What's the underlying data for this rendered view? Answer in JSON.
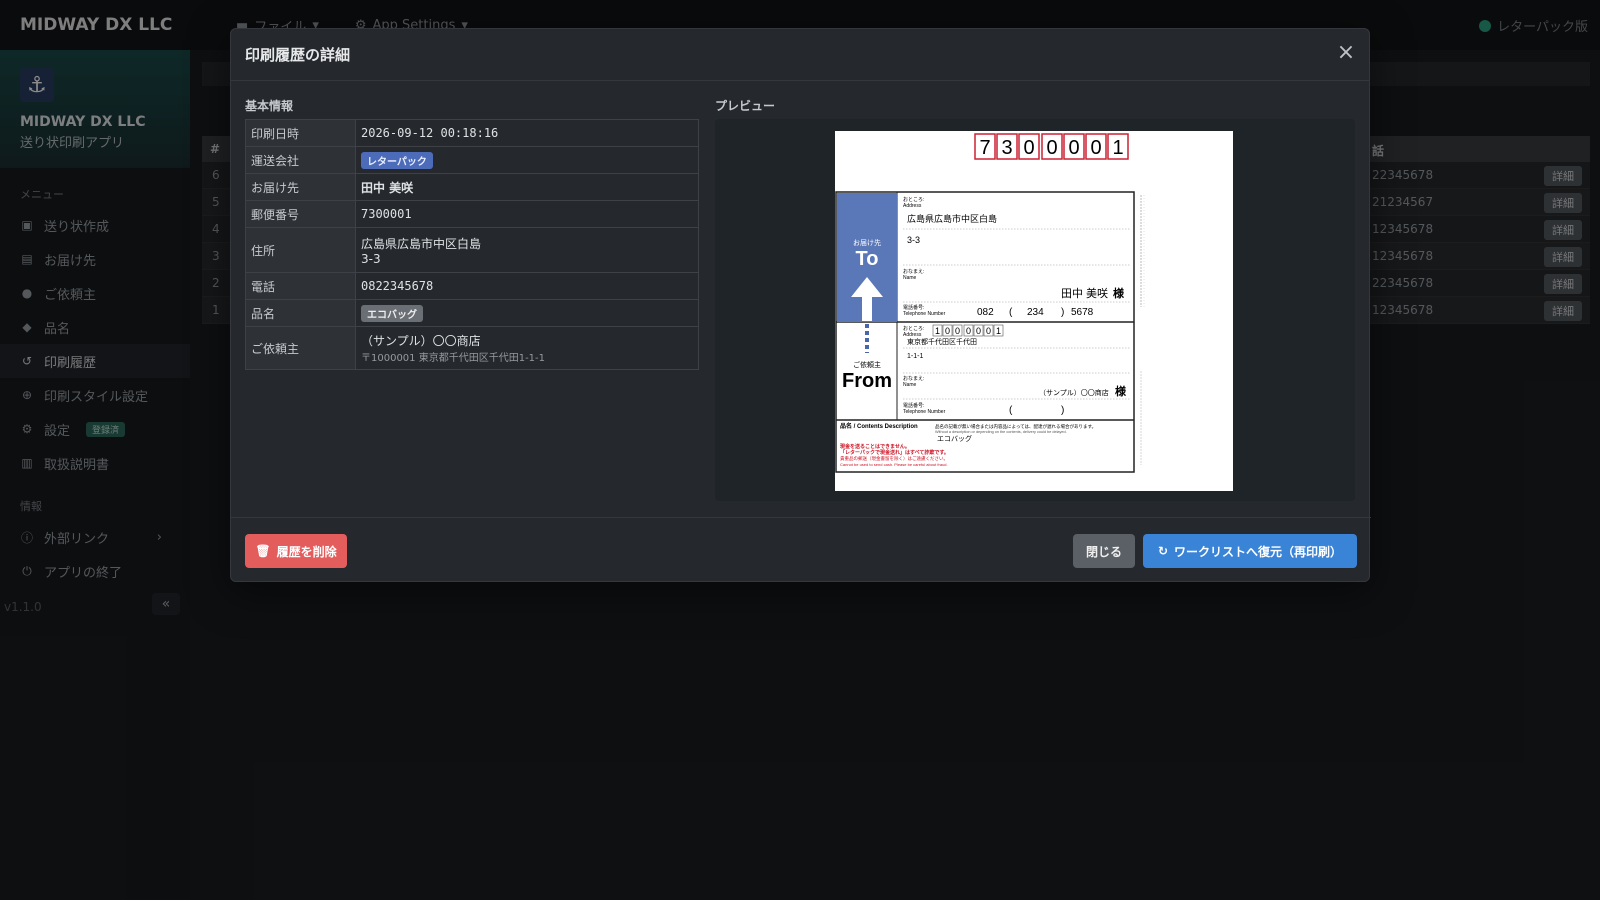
{
  "app": {
    "brand": "MIDWAY DX LLC",
    "top_menu": [
      "ファイル",
      "App Settings"
    ],
    "status_text": "レターパック版"
  },
  "sidebar": {
    "company": "MIDWAY DX LLC",
    "app_name": "送り状印刷アプリ",
    "menu_label": "メニュー",
    "menu_items": [
      "送り状作成",
      "お届け先",
      "ご依頼主",
      "品名",
      "印刷履歴",
      "印刷スタイル設定",
      "設定",
      "取扱説明書"
    ],
    "settings_badge": "登録済",
    "info_label": "情報",
    "info_items": [
      "外部リンク",
      "アプリの終了"
    ],
    "version": "v1.1.0"
  },
  "background_table": {
    "header_num": "#",
    "header_phone": "話",
    "rows": [
      {
        "num": "6",
        "phone": "22345678",
        "action": "詳細"
      },
      {
        "num": "5",
        "phone": "21234567",
        "action": "詳細"
      },
      {
        "num": "4",
        "phone": "12345678",
        "action": "詳細"
      },
      {
        "num": "3",
        "phone": "12345678",
        "action": "詳細"
      },
      {
        "num": "2",
        "phone": "22345678",
        "action": "詳細"
      },
      {
        "num": "1",
        "phone": "12345678",
        "action": "詳細"
      }
    ]
  },
  "modal": {
    "title": "印刷履歴の詳細",
    "basic_info_title": "基本情報",
    "preview_title": "プレビュー",
    "fields": {
      "printed_at_label": "印刷日時",
      "printed_at": "2026-09-12 00:18:16",
      "carrier_label": "運送会社",
      "carrier": "レターパック",
      "recipient_label": "お届け先",
      "recipient": "田中 美咲",
      "postal_label": "郵便番号",
      "postal": "7300001",
      "address_label": "住所",
      "address_line1": "広島県広島市中区白島",
      "address_line2": "3-3",
      "phone_label": "電話",
      "phone": "0822345678",
      "item_label": "品名",
      "item": "エコバッグ",
      "sender_label": "ご依頼主",
      "sender": "（サンプル）〇〇商店",
      "sender_address": "〒1000001 東京都千代田区千代田1-1-1"
    },
    "buttons": {
      "delete": "履歴を削除",
      "close": "閉じる",
      "restore": "ワークリストへ復元（再印刷）"
    }
  },
  "label_preview": {
    "postal_digits": [
      "7",
      "3",
      "0",
      "0",
      "0",
      "0",
      "1"
    ],
    "to_caption": "お届け先",
    "to_big": "To",
    "from_caption": "ご依頼主",
    "from_big": "From",
    "address_jp": "おところ:",
    "address_en": "Address",
    "name_jp": "おなまえ:",
    "name_en": "Name",
    "tel_jp": "電話番号:",
    "tel_en": "Telephone Number",
    "to_address1": "広島県広島市中区白島",
    "to_address2": "3-3",
    "to_name": "田中 美咲",
    "honorific": "様",
    "to_tel_area": "082",
    "to_tel_mid": "234",
    "to_tel_last": "5678",
    "from_postal_digits": [
      "1",
      "0",
      "0",
      "0",
      "0",
      "0",
      "1"
    ],
    "from_address1": "東京都千代田区千代田",
    "from_address2": "1-1-1",
    "from_name": "（サンプル）〇〇商店",
    "contents_label": "品名 / Contents Description",
    "contents_note": "品名の記載が無い場合または内容品によっては、配達が遅れる場合があります。",
    "contents_note_en": "Without a description or depending on the contents, delivery could be delayed.",
    "contents_value": "エコバッグ",
    "cash_warning1": "現金を送ることはできません。",
    "cash_warning2": "「レターパックで現金送れ」はすべて詐欺です。",
    "cash_warning3": "貴重品の郵送（現金書留を除く）はご遠慮ください。",
    "cash_warning_en": "Cannot be used to send cash. Please be careful about fraud."
  }
}
